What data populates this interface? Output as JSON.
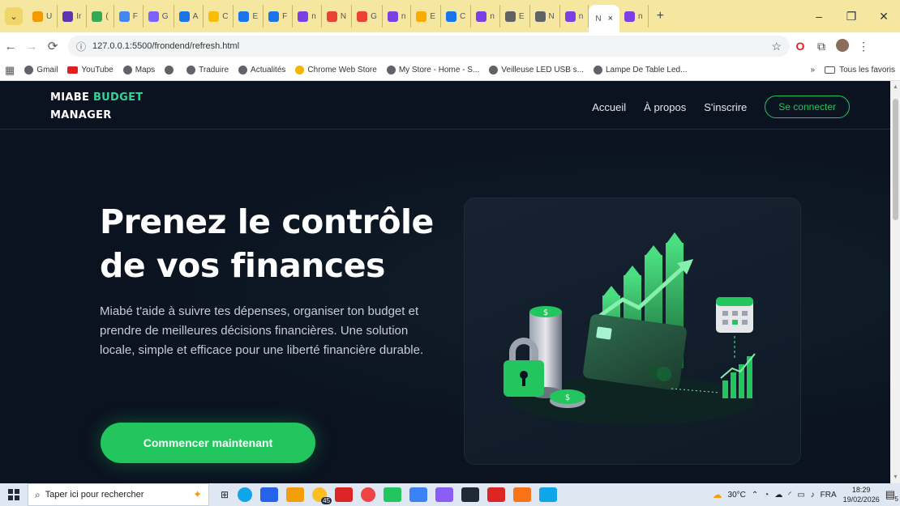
{
  "browser": {
    "tabs": [
      {
        "label": "U",
        "color": "#f29900"
      },
      {
        "label": "Ir",
        "color": "#5e35b1"
      },
      {
        "label": "(",
        "color": "#34a853"
      },
      {
        "label": "F",
        "color": "#4285f4"
      },
      {
        "label": "G",
        "color": "#7b61ff"
      },
      {
        "label": "A",
        "color": "#1a73e8"
      },
      {
        "label": "C",
        "color": "#fbbc04"
      },
      {
        "label": "E",
        "color": "#1a73e8"
      },
      {
        "label": "F",
        "color": "#1a73e8"
      },
      {
        "label": "n",
        "color": "#7b3fe4"
      },
      {
        "label": "N",
        "color": "#ea4335"
      },
      {
        "label": "G",
        "color": "#ea4335"
      },
      {
        "label": "n",
        "color": "#7b3fe4"
      },
      {
        "label": "E",
        "color": "#f9ab00"
      },
      {
        "label": "C",
        "color": "#1a73e8"
      },
      {
        "label": "n",
        "color": "#7b3fe4"
      },
      {
        "label": "E",
        "color": "#5f6368"
      },
      {
        "label": "N",
        "color": "#5f6368"
      },
      {
        "label": "n",
        "color": "#7b3fe4"
      }
    ],
    "active_tab": {
      "label": "N",
      "close": "×"
    },
    "extra_tab": {
      "label": "n",
      "color": "#7b3fe4"
    },
    "new_tab": "+",
    "window": {
      "minimize": "–",
      "maximize": "❐",
      "close": "✕"
    },
    "url": "127.0.0.1:5500/frondend/refresh.html",
    "bookmarks": [
      {
        "label": "Gmail",
        "icon": "globe"
      },
      {
        "label": "YouTube",
        "icon": "youtube"
      },
      {
        "label": "Maps",
        "icon": "globe"
      },
      {
        "label": "",
        "icon": "globe"
      },
      {
        "label": "Traduire",
        "icon": "globe"
      },
      {
        "label": "Actualités",
        "icon": "globe"
      },
      {
        "label": "Chrome Web Store",
        "icon": "webstore"
      },
      {
        "label": "My Store - Home - S...",
        "icon": "globe"
      },
      {
        "label": "Veilleuse LED USB s...",
        "icon": "globe"
      },
      {
        "label": "Lampe De Table Led...",
        "icon": "globe"
      }
    ],
    "bookmarks_more": "»",
    "all_bookmarks": "Tous les favoris"
  },
  "site": {
    "brand_line1_a": "MIABE ",
    "brand_line1_b": "BUDGET",
    "brand_line2": "MANAGER",
    "nav": {
      "home": "Accueil",
      "about": "À propos",
      "signup": "S'inscrire",
      "login": "Se connecter"
    },
    "hero": {
      "title_line1": "Prenez le contrôle",
      "title_line2": "de vos finances",
      "text": "Miabé t'aide à suivre tes dépenses, organiser ton budget et prendre de meilleures décisions financières. Une solution locale, simple et efficace pour une liberté financière durable.",
      "cta": "Commencer maintenant"
    },
    "colors": {
      "accent": "#22c55e",
      "background": "#0b1220"
    }
  },
  "taskbar": {
    "search_placeholder": "Taper ici pour rechercher",
    "weather": "30°C",
    "language": "FRA",
    "time": "18:29",
    "date": "19/02/2026",
    "notifications": "5",
    "badge": "45"
  }
}
